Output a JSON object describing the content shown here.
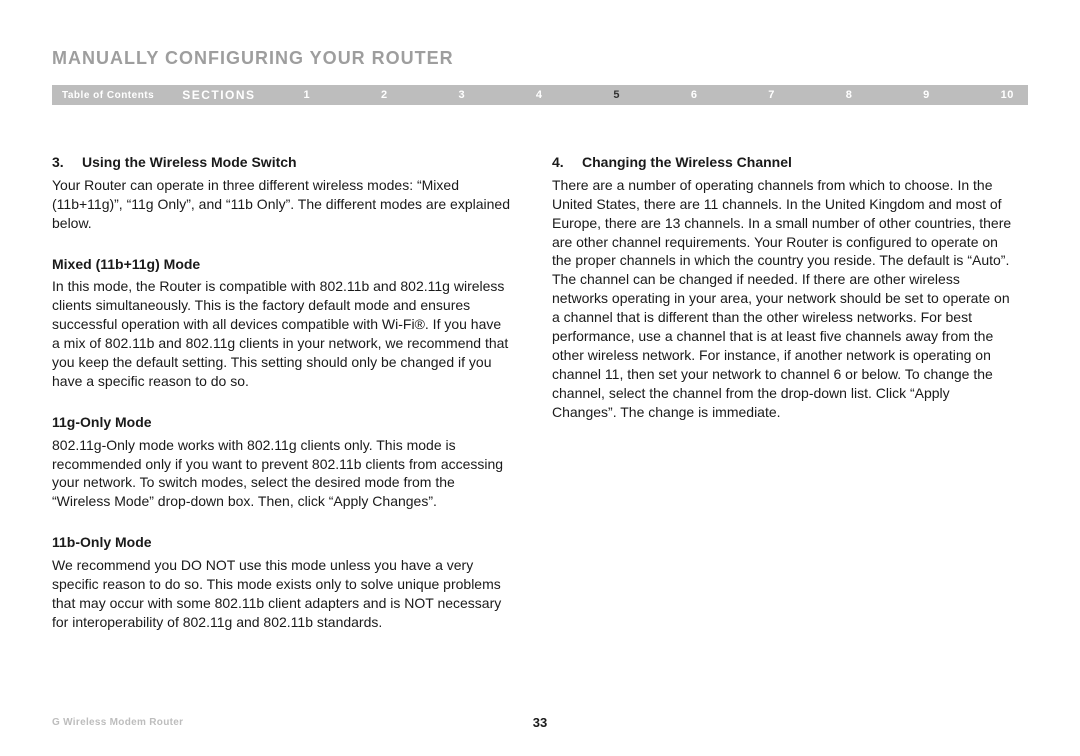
{
  "title": "MANUALLY CONFIGURING YOUR ROUTER",
  "nav": {
    "toc": "Table of Contents",
    "sections": "SECTIONS",
    "items": [
      "1",
      "2",
      "3",
      "4",
      "5",
      "6",
      "7",
      "8",
      "9",
      "10"
    ],
    "active": "5"
  },
  "left": {
    "h3_num": "3.",
    "h3": "Using the Wireless Mode Switch",
    "p1": "Your Router can operate in three different wireless modes: “Mixed (11b+11g)”, “11g Only”, and “11b Only”. The different modes are explained below.",
    "sub1": "Mixed (11b+11g) Mode",
    "p2": "In this mode, the Router is compatible with 802.11b and 802.11g wireless clients simultaneously. This is the factory default mode and ensures successful operation with all devices compatible with Wi-Fi®. If you have a mix of 802.11b and 802.11g clients in your network, we recommend that you keep the default setting. This setting should only be changed if you have a specific reason to do so.",
    "sub2": "11g-Only Mode",
    "p3": "802.11g-Only mode works with 802.11g clients only. This mode is recommended only if you want to prevent 802.11b clients from accessing your network. To switch modes, select the desired mode from the “Wireless Mode” drop-down box. Then, click “Apply Changes”.",
    "sub3": "11b-Only Mode",
    "p4": "We recommend you DO NOT use this mode unless you have a very specific reason to do so. This mode exists only to solve unique problems that may occur with some 802.11b client adapters and is NOT necessary for interoperability of 802.11g and 802.11b standards."
  },
  "right": {
    "h4_num": "4.",
    "h4": "Changing the Wireless Channel",
    "p1": "There are a number of operating channels from which to choose. In the United States, there are 11 channels. In the United Kingdom and most of Europe, there are 13 channels. In a small number of other countries, there are other channel requirements. Your Router is configured to operate on the proper channels in which the country you reside. The default is “Auto”. The channel can be changed if needed. If there are other wireless networks operating in your area, your network should be set to operate on a channel that is different than the other wireless networks. For best performance, use a channel that is at least five channels away from the other wireless network. For instance, if another network is operating on channel 11, then set your network to channel 6 or below. To change the channel, select the channel from the drop-down list. Click “Apply Changes”. The change is immediate."
  },
  "footer": {
    "product": "G Wireless Modem Router",
    "page": "33"
  }
}
